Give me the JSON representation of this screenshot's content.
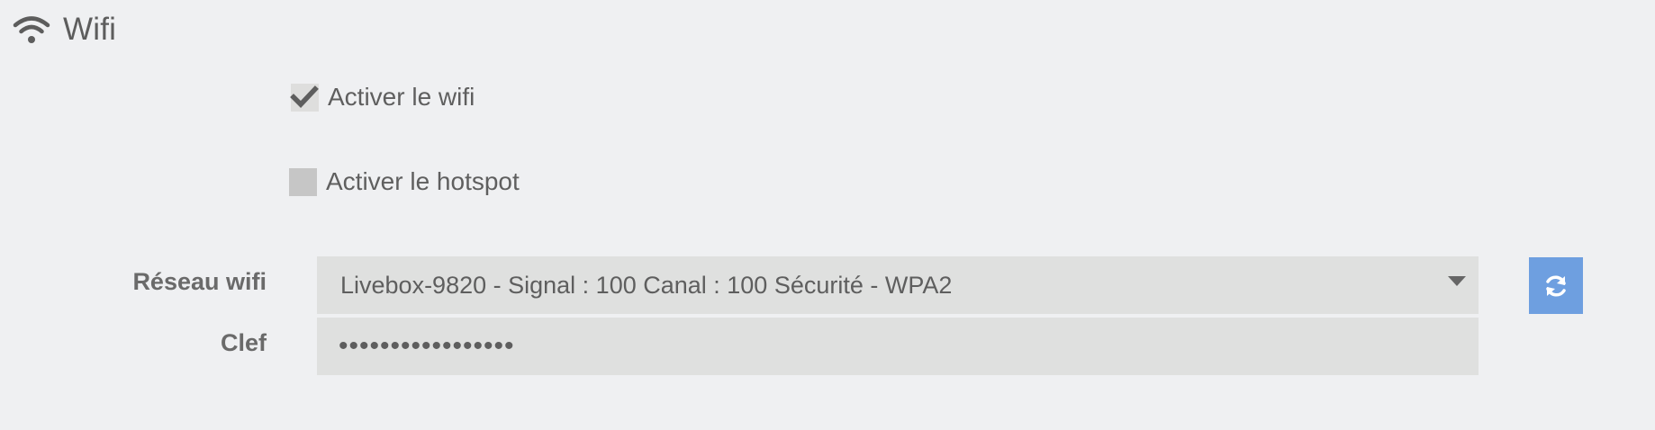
{
  "section": {
    "title": "Wifi",
    "icon": "wifi-icon"
  },
  "options": {
    "enable_wifi": {
      "label": "Activer le wifi",
      "checked": true
    },
    "enable_hotspot": {
      "label": "Activer le hotspot",
      "checked": false
    }
  },
  "form": {
    "network_label": "Réseau wifi",
    "network_value": "Livebox-9820 - Signal : 100 Canal : 100 Sécurité - WPA2",
    "key_label": "Clef",
    "key_value": "•••••••••••••••••"
  },
  "actions": {
    "refresh_icon": "refresh-icon"
  },
  "colors": {
    "background": "#eff0f2",
    "field_background": "#dfe0df",
    "accent": "#6e9fe0",
    "text": "#656565"
  }
}
